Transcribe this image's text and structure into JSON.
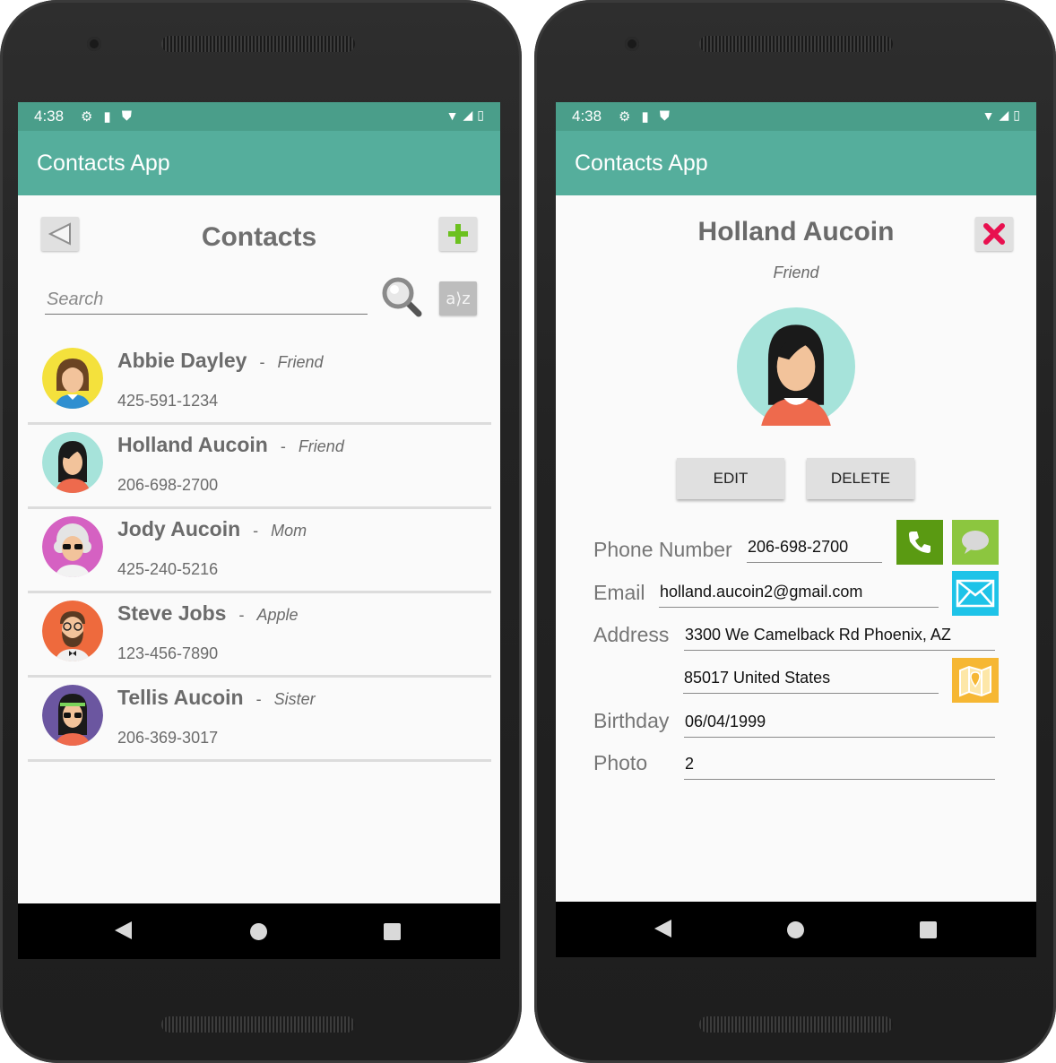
{
  "status": {
    "time": "4:38"
  },
  "app": {
    "title": "Contacts App"
  },
  "list_screen": {
    "title": "Contacts",
    "search_placeholder": "Search",
    "sort_label": "a2z"
  },
  "contacts": [
    {
      "name": "Abbie Dayley",
      "relationship": "Friend",
      "phone": "425-591-1234"
    },
    {
      "name": "Holland Aucoin",
      "relationship": "Friend",
      "phone": "206-698-2700"
    },
    {
      "name": "Jody Aucoin",
      "relationship": "Mom",
      "phone": "425-240-5216"
    },
    {
      "name": "Steve Jobs",
      "relationship": "Apple",
      "phone": "123-456-7890"
    },
    {
      "name": "Tellis Aucoin",
      "relationship": "Sister",
      "phone": "206-369-3017"
    }
  ],
  "separator": "-",
  "detail_screen": {
    "name": "Holland Aucoin",
    "relationship": "Friend",
    "edit_label": "EDIT",
    "delete_label": "DELETE",
    "labels": {
      "phone": "Phone Number",
      "email": "Email",
      "address": "Address",
      "birthday": "Birthday",
      "photo": "Photo"
    },
    "values": {
      "phone": "206-698-2700",
      "email": "holland.aucoin2@gmail.com",
      "address_line1": "3300 We Camelback Rd Phoenix, AZ",
      "address_line2": "85017 United States",
      "birthday": "06/04/1999",
      "photo": "2"
    }
  },
  "colors": {
    "status_bar": "#4a9e8a",
    "app_bar": "#55ae9c",
    "call": "#5a9a12",
    "message": "#8cc63f",
    "email": "#1ec3e8",
    "map": "#f6b733",
    "delete_x": "#e8104f"
  }
}
